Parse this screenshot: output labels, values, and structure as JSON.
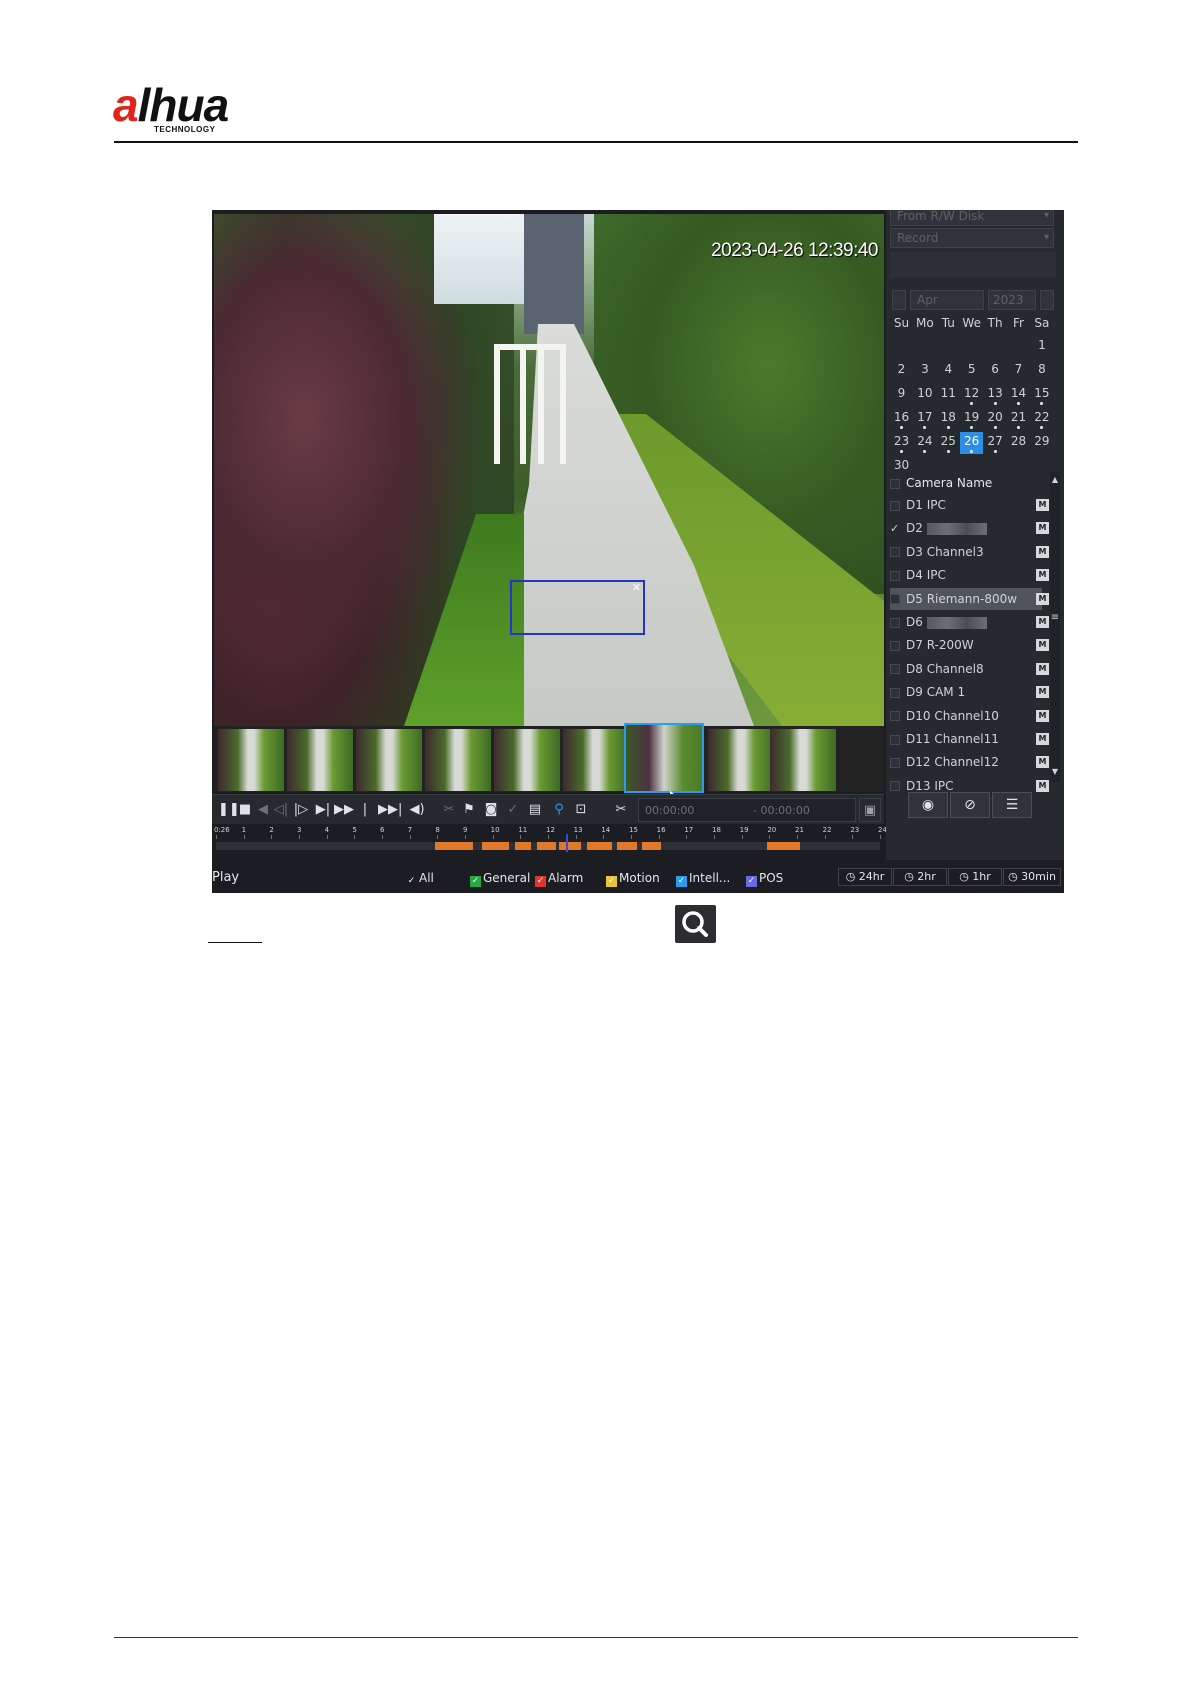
{
  "header": {
    "logo_text_red": "a",
    "logo_text_black": "lhua",
    "logo_subtext": "TECHNOLOGY"
  },
  "video": {
    "timestamp": "2023-04-26 12:39:40"
  },
  "controls": {
    "icons": [
      "pause-icon",
      "stop-icon",
      "play-reverse-icon",
      "prev-frame-icon",
      "next-frame-icon",
      "slow-play-icon",
      "fast-forward-icon",
      "prev-record-icon",
      "next-record-icon",
      "volume-icon",
      "clip-cut-icon",
      "tag-icon",
      "snapshot-icon",
      "lock-icon",
      "smart-search-icon",
      "ai-search-icon",
      "zoom-icon",
      "scissors-icon",
      "save-icon"
    ],
    "clip_start": "00:00:00",
    "clip_end": "- 00:00:00"
  },
  "timeline": {
    "ticks": [
      "0:26",
      "1",
      "2",
      "3",
      "4",
      "5",
      "6",
      "7",
      "8",
      "9",
      "10",
      "11",
      "12",
      "13",
      "14",
      "15",
      "16",
      "17",
      "18",
      "19",
      "20",
      "21",
      "22",
      "23",
      "24"
    ],
    "current_hour": 12.65
  },
  "panel": {
    "source_dropdown": "From R/W Disk",
    "type_dropdown": "Record",
    "month": "Apr",
    "year": "2023",
    "weekdays": [
      "Su",
      "Mo",
      "Tu",
      "We",
      "Th",
      "Fr",
      "Sa"
    ],
    "days": [
      "1",
      "2",
      "3",
      "4",
      "5",
      "6",
      "7",
      "8",
      "9",
      "10",
      "11",
      "12",
      "13",
      "14",
      "15",
      "16",
      "17",
      "18",
      "19",
      "20",
      "21",
      "22",
      "23",
      "24",
      "25",
      "26",
      "27",
      "28",
      "29",
      "30"
    ],
    "first_weekday_index": 6,
    "selected_day": "26",
    "days_with_records": [
      "12",
      "13",
      "14",
      "15",
      "16",
      "17",
      "18",
      "19",
      "20",
      "21",
      "22",
      "23",
      "24",
      "25",
      "26",
      "27"
    ],
    "camera_header": "Camera Name",
    "cameras": [
      {
        "name": "D1 IPC",
        "checked": false
      },
      {
        "name": "D2",
        "checked": true,
        "blurred": true
      },
      {
        "name": "D3 Channel3",
        "checked": false
      },
      {
        "name": "D4 IPC",
        "checked": false
      },
      {
        "name": "D5 Riemann-800w",
        "checked": false,
        "highlight": true
      },
      {
        "name": "D6",
        "checked": false,
        "blurred": true
      },
      {
        "name": "D7 R-200W",
        "checked": false
      },
      {
        "name": "D8 Channel8",
        "checked": false
      },
      {
        "name": "D9 CAM 1",
        "checked": false
      },
      {
        "name": "D10 Channel10",
        "checked": false
      },
      {
        "name": "D11 Channel11",
        "checked": false
      },
      {
        "name": "D12 Channel12",
        "checked": false
      },
      {
        "name": "D13 IPC",
        "checked": false
      }
    ],
    "camera_mode_label": "M",
    "tools": [
      "sync-play-icon",
      "smart-search-off-icon",
      "file-list-icon"
    ]
  },
  "status": {
    "play_label": "Play",
    "legend": [
      {
        "label": "All",
        "color": "#1b1d22"
      },
      {
        "label": "General",
        "color": "#27a844"
      },
      {
        "label": "Alarm",
        "color": "#e0342c"
      },
      {
        "label": "Motion",
        "color": "#e8c43a"
      },
      {
        "label": "Intell...",
        "color": "#2b9cf0"
      },
      {
        "label": "POS",
        "color": "#6a6ae0"
      }
    ],
    "time_buttons": [
      "24hr",
      "2hr",
      "1hr",
      "30min"
    ]
  },
  "colors": {
    "accent": "#2b9cf0",
    "panel_bg": "#26292e",
    "record_bar": "#e07a2a"
  }
}
